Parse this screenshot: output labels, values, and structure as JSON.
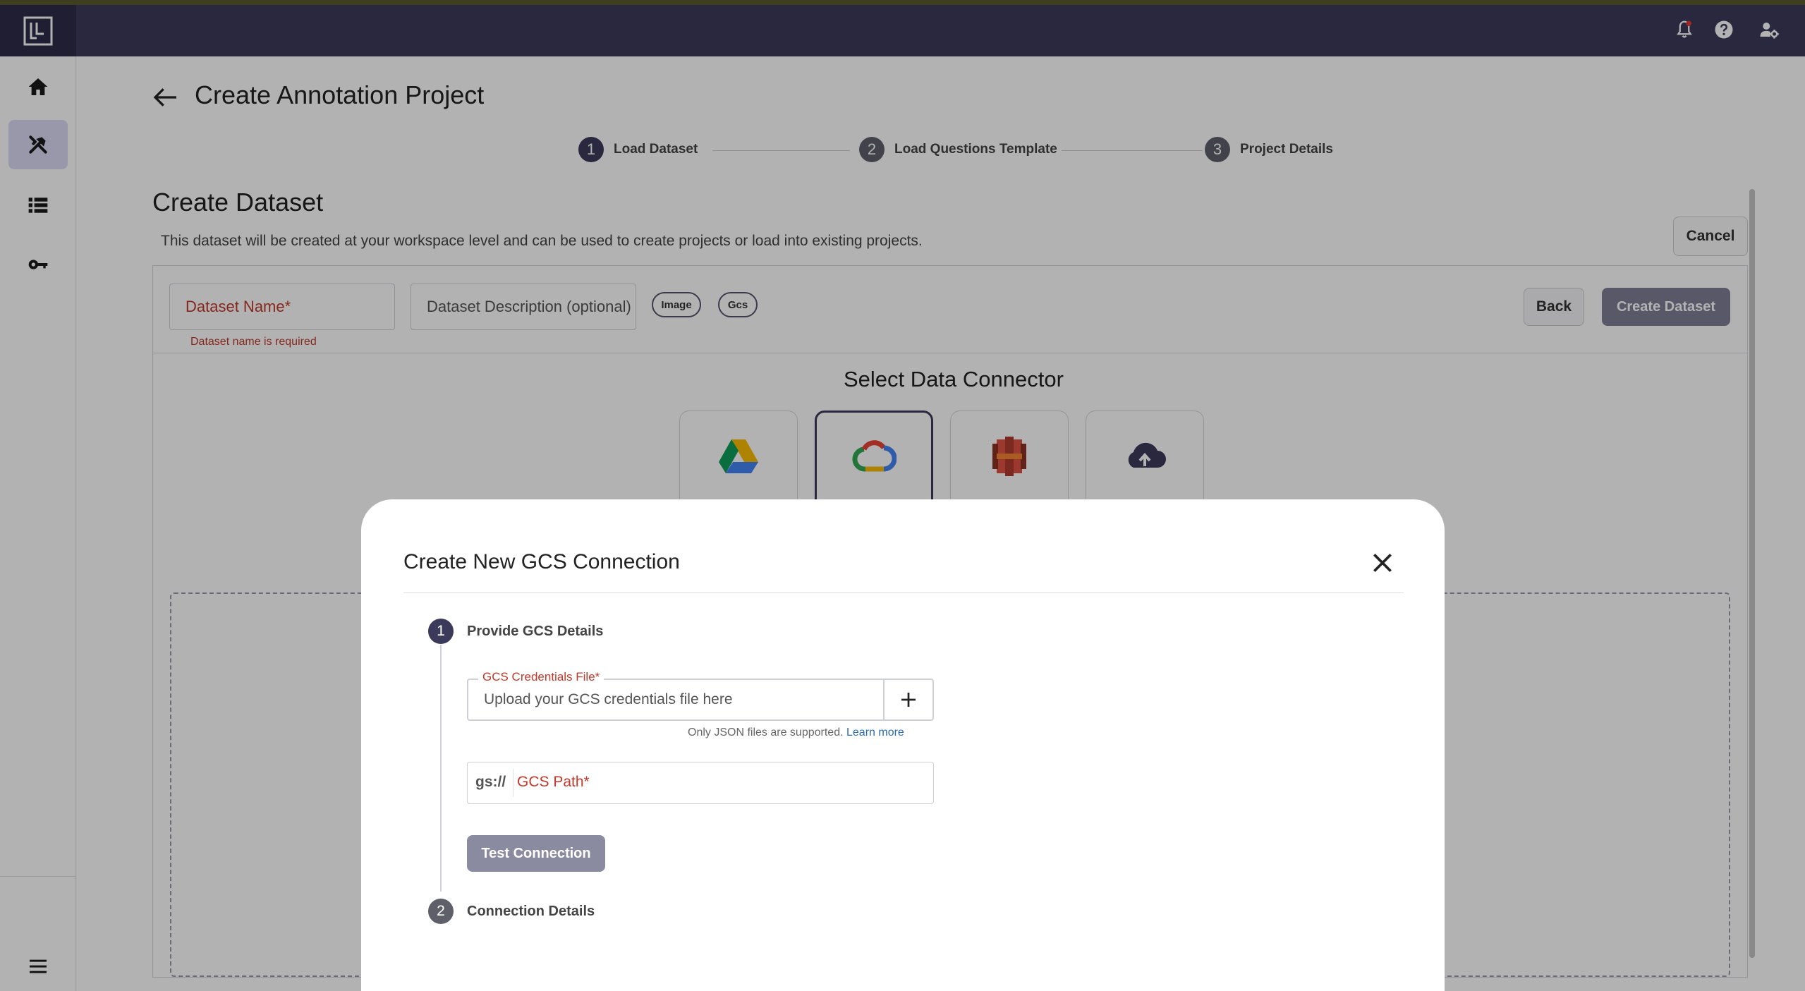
{
  "header": {
    "icons": [
      "notification-bell-icon",
      "help-icon",
      "user-settings-icon"
    ]
  },
  "sidebar": {
    "items": [
      "home-icon",
      "tools-icon",
      "list-icon",
      "key-icon"
    ],
    "active_index": 1,
    "bottom": "menu-icon",
    "active_bg": "#dcd9f4"
  },
  "page": {
    "title": "Create Annotation Project"
  },
  "stepper": {
    "steps": [
      {
        "num": "1",
        "label": "Load Dataset",
        "state": "active"
      },
      {
        "num": "2",
        "label": "Load Questions Template",
        "state": "inactive"
      },
      {
        "num": "3",
        "label": "Project Details",
        "state": "inactive"
      }
    ]
  },
  "dataset": {
    "title": "Create Dataset",
    "description": "This dataset will be created at your workspace level and can be used to create projects or load into existing projects.",
    "cancel_label": "Cancel",
    "name_placeholder": "Dataset Name*",
    "name_error": "Dataset name is required",
    "desc_placeholder": "Dataset Description (optional)",
    "chips": [
      "Image",
      "Gcs"
    ],
    "back_label": "Back",
    "create_label": "Create Dataset"
  },
  "connector": {
    "title": "Select Data Connector",
    "options": [
      "google-drive-icon",
      "google-cloud-icon",
      "aws-s3-icon",
      "cloud-upload-icon"
    ],
    "selected_index": 1
  },
  "modal": {
    "title": "Create New GCS Connection",
    "step1": {
      "num": "1",
      "label": "Provide GCS Details"
    },
    "credentials": {
      "legend": "GCS Credentials File*",
      "placeholder": "Upload your GCS credentials file here",
      "help": "Only JSON files are supported.",
      "link": "Learn more"
    },
    "path": {
      "prefix": "gs://",
      "placeholder": "GCS Path*"
    },
    "test_label": "Test Connection",
    "step2": {
      "num": "2",
      "label": "Connection Details"
    }
  },
  "colors": {
    "header": "#3b3a5a",
    "step_active": "#3b3a5a",
    "step_inactive": "#5f5f6a",
    "error": "#c0392b",
    "link": "#2b6cb0"
  }
}
